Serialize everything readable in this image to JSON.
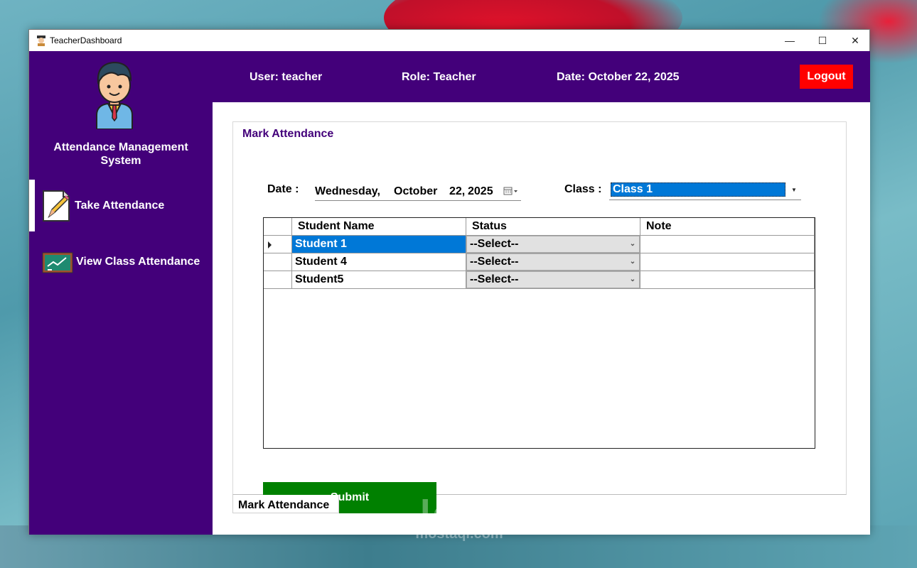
{
  "window": {
    "title": "TeacherDashboard",
    "minimize": "—",
    "maximize": "☐",
    "close": "✕"
  },
  "sidebar": {
    "app_name_line1": "Attendance Management",
    "app_name_line2": "System",
    "items": [
      {
        "label": "Take Attendance",
        "icon": "pencil-note-icon",
        "active": true
      },
      {
        "label": "View Class Attendance",
        "icon": "chalkboard-icon",
        "active": false
      }
    ]
  },
  "header": {
    "user": "User: teacher",
    "role": "Role: Teacher",
    "date": "Date: October 22, 2025",
    "logout_label": "Logout",
    "background": "#43007a",
    "logout_color": "#ff0000"
  },
  "panel": {
    "title": "Mark Attendance",
    "tab_label": "Mark Attendance",
    "date_label": "Date :",
    "date_value": {
      "weekday": "Wednesday,",
      "month": "October",
      "day": "22,",
      "year": "2025"
    },
    "class_label": "Class :",
    "class_value": "Class 1",
    "submit_label": "Submit",
    "submit_color": "#008000"
  },
  "grid": {
    "columns": [
      "Student Name",
      "Status",
      "Note"
    ],
    "rows": [
      {
        "name": "Student 1",
        "status": "--Select--",
        "note": "",
        "selected": true
      },
      {
        "name": "Student 4",
        "status": "--Select--",
        "note": "",
        "selected": false
      },
      {
        "name": "Student5",
        "status": "--Select--",
        "note": "",
        "selected": false
      }
    ]
  },
  "watermark": {
    "arabic": "مستقل",
    "latin": "mostaql.com"
  }
}
